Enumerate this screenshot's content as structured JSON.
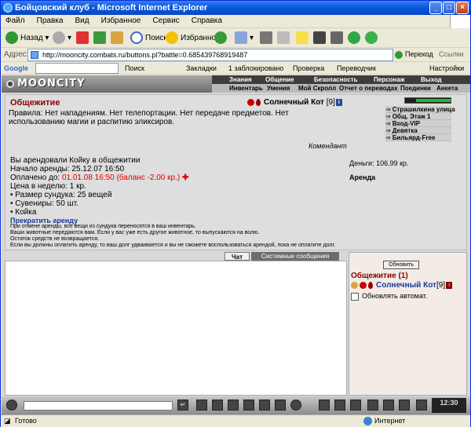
{
  "window": {
    "title": "Бойцовский клуб - Microsoft Internet Explorer"
  },
  "menu": [
    "Файл",
    "Правка",
    "Вид",
    "Избранное",
    "Сервис",
    "Справка"
  ],
  "toolbar": {
    "back": "Назад",
    "search": "Поиск",
    "favorites": "Избранное"
  },
  "address": {
    "label": "Адрес:",
    "url": "http://mooncity.combats.ru/buttons.pl?battle=0.685439768919487",
    "go": "Переход",
    "links": "Ссылки"
  },
  "google": {
    "logo": "Google",
    "search": "Поиск",
    "bookmarks": "Закладки",
    "blocked": "1 заблокировано",
    "check": "Проверка",
    "translate": "Переводчик",
    "settings": "Настройки"
  },
  "site": {
    "logo": "MOONCITY",
    "nav_top": [
      "Знания",
      "Общение",
      "Безопасность",
      "Персонаж",
      "Выход"
    ],
    "nav_bottom": [
      "Инвентарь",
      "Умения",
      "Мой Скролл",
      "Отчет о переводах",
      "Поединки",
      "Анкета"
    ]
  },
  "room": {
    "title": "Общежитие",
    "player": {
      "name": "Солнечный Кот",
      "level": "[9]"
    },
    "rules": "Правила: Нет нападениям. Нет телепортации. Нет передаче предметов. Нет использованию магии и распитию эликсиров.",
    "signature": "Комендант",
    "exits": [
      "Страшилкина улица",
      "Общ. Этаж 1",
      "Вход-VIP",
      "Девятка",
      "Бильярд-Free"
    ],
    "rent": {
      "line1": "Вы арендовали Койку в общежитии",
      "start": "Начало аренды: 25.12.07 16:50",
      "paid_label": "Оплачено до: ",
      "paid_value": "01.01.08 16:50 (баланс -2.00 кр.)",
      "price": "Цена в неделю: 1 кр.",
      "bullets": [
        "• Размер сундука: 25 вещей",
        "• Сувениры: 50 шт.",
        "• Койка"
      ]
    },
    "money": "Деньги: 106.99 кр.",
    "rent_header": "Аренда",
    "stop_link": "Прекратить аренду",
    "notes": [
      "При отмене аренды, все вещи из сундука переносятся в ваш инвентарь.",
      "Ваши животные передаются вам. Если у вас уже есть другое животное, то выпускаются на волю.",
      "Остаток средств не возвращается.",
      "Если вы должны оплатить аренду, то ваш долг удваивается и вы не сможете воспользоваться арендой, пока не оплатите долг."
    ]
  },
  "chat": {
    "tab_chat": "Чат",
    "tab_system": "Системные сообщения"
  },
  "online": {
    "refresh": "Обновить",
    "title": "Общежитие (1)",
    "user": "Солнечный Кот",
    "level": "[9]",
    "auto_refresh": "Обновлять автомат."
  },
  "bottom": {
    "clock": "12:30"
  },
  "status": {
    "left": "Готово",
    "zone": "Интернет"
  }
}
